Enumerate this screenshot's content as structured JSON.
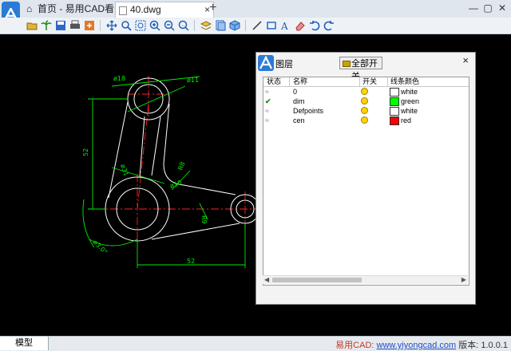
{
  "app": {
    "home_tab": "首页 - 易用CAD看图",
    "doc_tab": "40.dwg",
    "new_tab": "+"
  },
  "toolbar_icons": [
    "open-icon",
    "palm-icon",
    "save-icon",
    "print-icon",
    "export-icon",
    "pan-icon",
    "zoom-window-icon",
    "zoom-extents-icon",
    "zoom-in-icon",
    "zoom-out-icon",
    "zoom-prev-icon",
    "layer-icon",
    "layout-icon",
    "3d-icon",
    "line-icon",
    "rect-icon",
    "text-icon",
    "erase-icon",
    "undo-icon",
    "redo-icon"
  ],
  "drawing": {
    "dims": {
      "d18": "ø18",
      "d11": "ø11",
      "d31": "ø31",
      "r8": "R8",
      "d10": "ø10",
      "r9": "R9",
      "len52v": "52",
      "len52h": "52",
      "ang": "ø3.0°"
    }
  },
  "layer_panel": {
    "title": "图层",
    "all_toggle": "全部开关",
    "close": "×",
    "columns": [
      "状态",
      "名称",
      "开关",
      "线条颜色"
    ],
    "layers": [
      {
        "current": false,
        "name": "0",
        "on": true,
        "color": "#ffffff",
        "color_name": "white"
      },
      {
        "current": true,
        "name": "dim",
        "on": true,
        "color": "#00ff00",
        "color_name": "green"
      },
      {
        "current": false,
        "name": "Defpoints",
        "on": true,
        "color": "#ffffff",
        "color_name": "white"
      },
      {
        "current": false,
        "name": "cen",
        "on": true,
        "color": "#ff0000",
        "color_name": "red"
      }
    ]
  },
  "status": {
    "space_tab": "模型",
    "brand_prefix": "易用CAD:",
    "url": "www.yiyongcad.com",
    "version_label": "版本: 1.0.0.1"
  }
}
